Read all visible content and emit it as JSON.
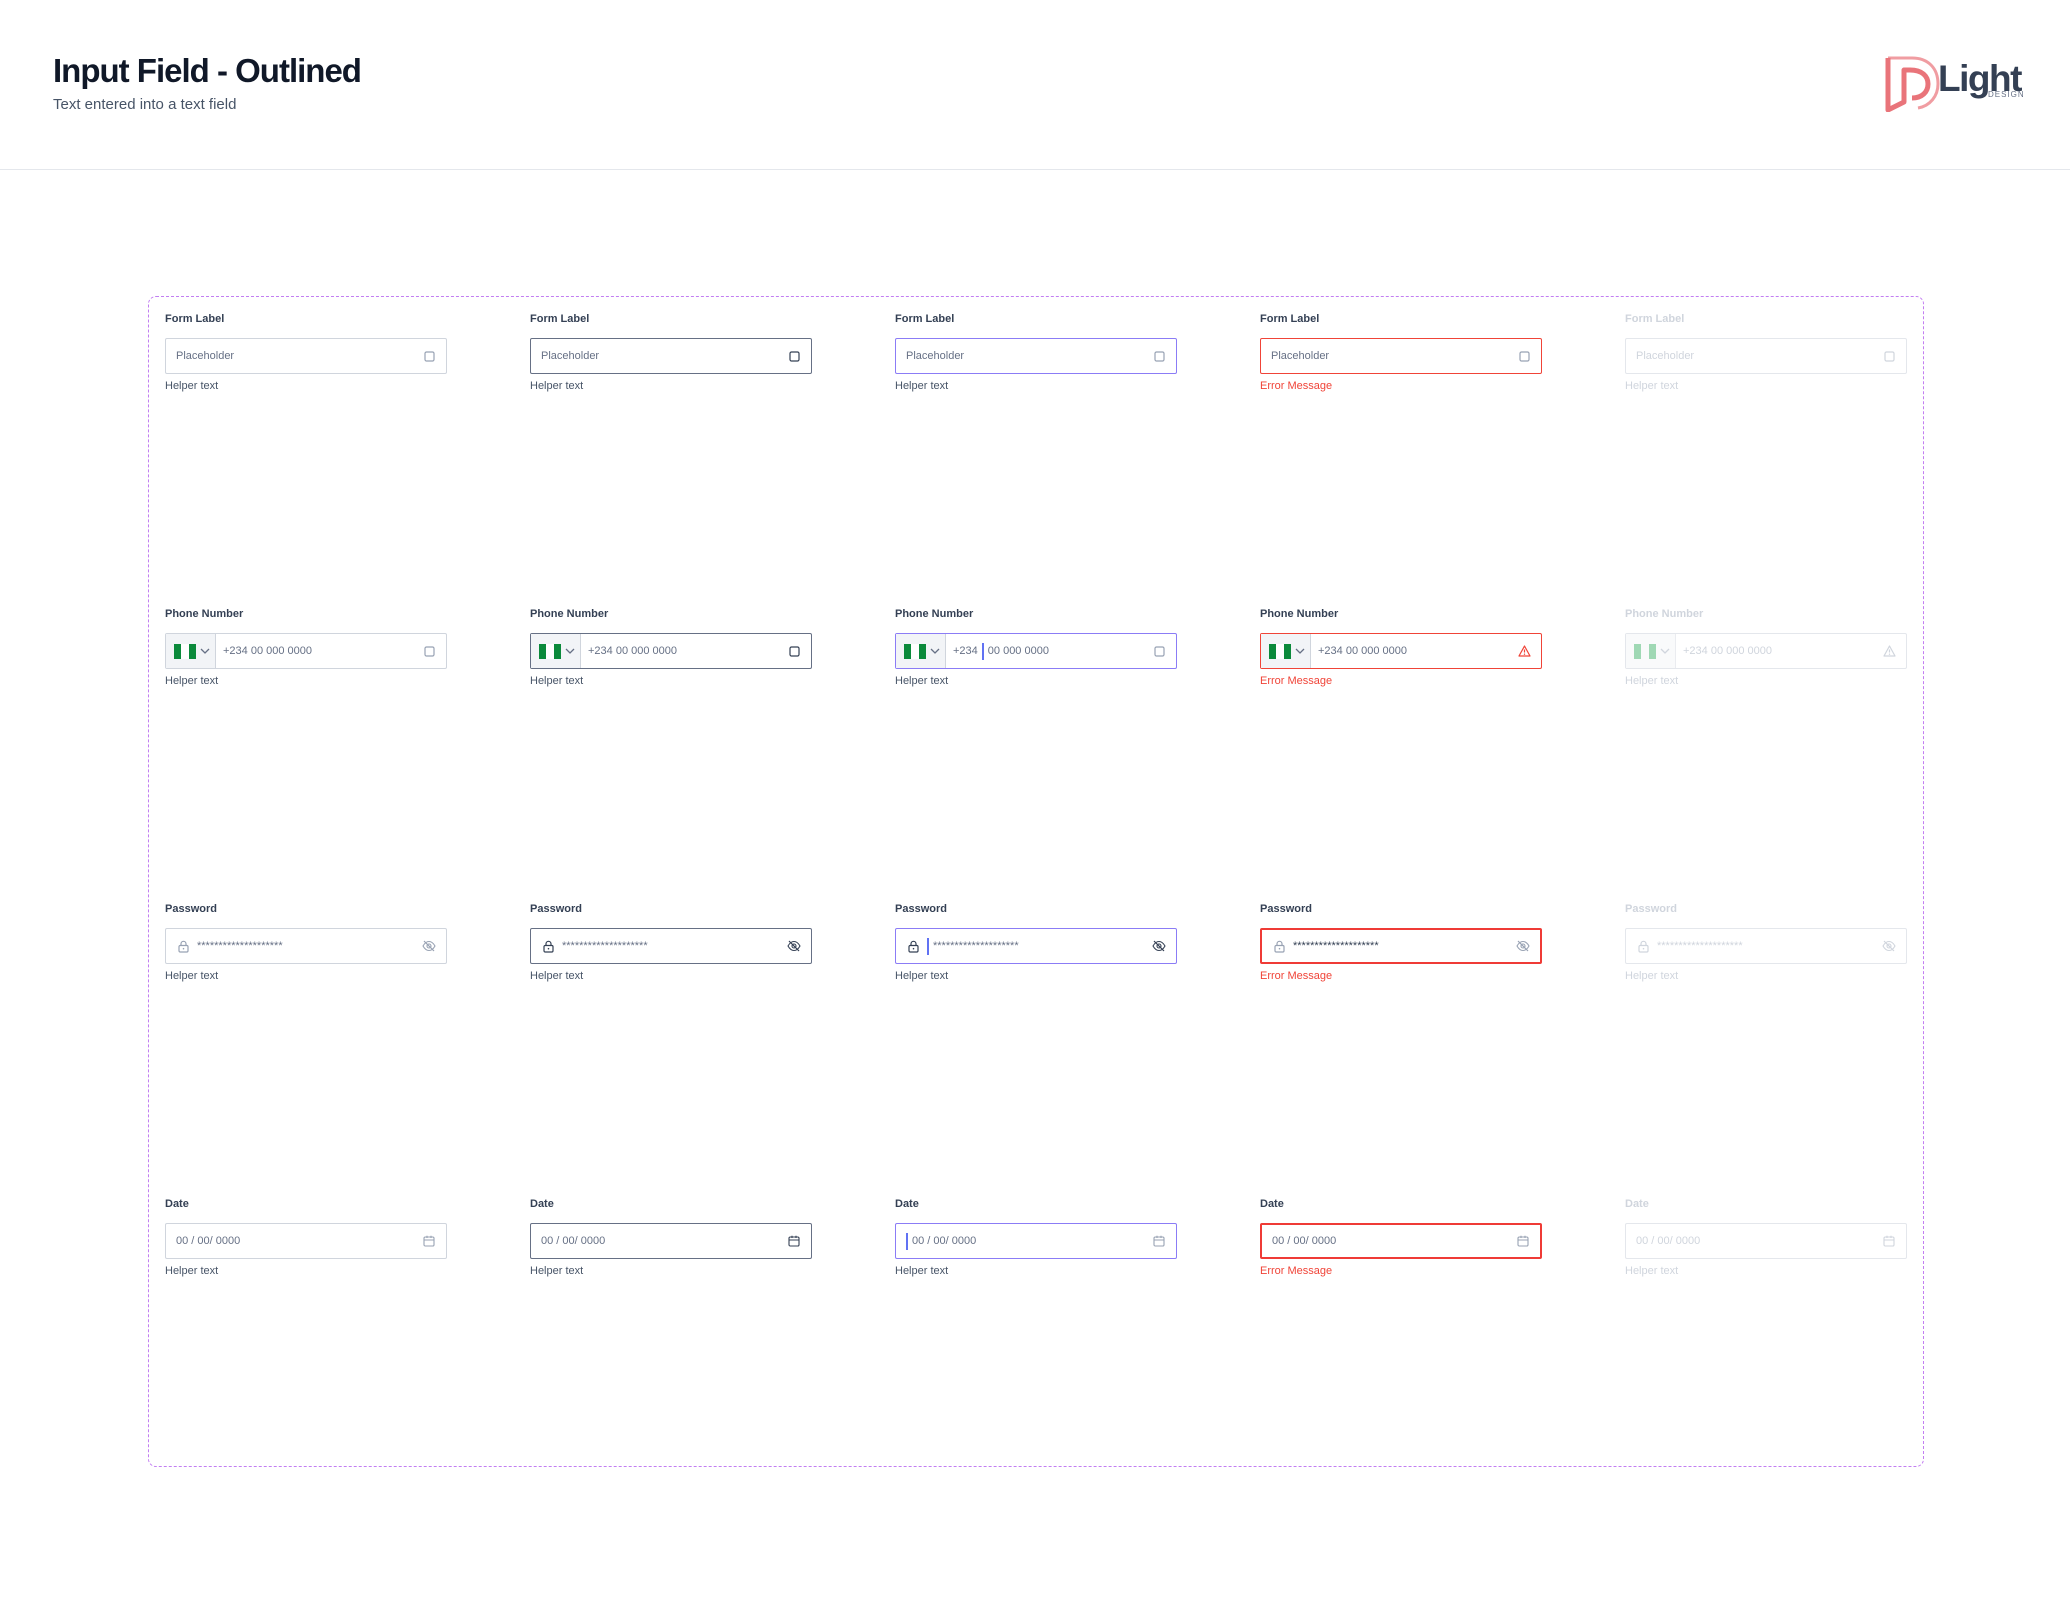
{
  "header": {
    "title": "Input Field - Outlined",
    "subtitle": "Text entered into a text field",
    "logo_text": "Light",
    "logo_sub": "DESIGN",
    "brand_color": "#e9747a"
  },
  "colors": {
    "focus": "#8b7cf6",
    "error": "#f04438",
    "frame": "#c27ef2"
  },
  "states": [
    "default",
    "hover",
    "focus",
    "error",
    "disabled"
  ],
  "rows": {
    "text": {
      "label": "Form Label",
      "placeholder": "Placeholder",
      "helper": "Helper text",
      "error": "Error Message",
      "trailing_icon": "square-icon"
    },
    "phone": {
      "label": "Phone Number",
      "value": "+234 00 000 0000",
      "prefix": "+234",
      "number": "00 000 0000",
      "helper": "Helper text",
      "error": "Error Message",
      "flag": "nigeria-flag-icon",
      "trailing_icon": "square-icon",
      "error_icon": "alert-triangle-icon"
    },
    "password": {
      "label": "Password",
      "value": "********************",
      "helper": "Helper text",
      "error": "Error Message",
      "leading_icon": "lock-icon",
      "trailing_icon": "eye-off-icon"
    },
    "date": {
      "label": "Date",
      "value": "00 / 00/ 0000",
      "helper": "Helper text",
      "error": "Error Message",
      "trailing_icon": "calendar-icon"
    }
  }
}
